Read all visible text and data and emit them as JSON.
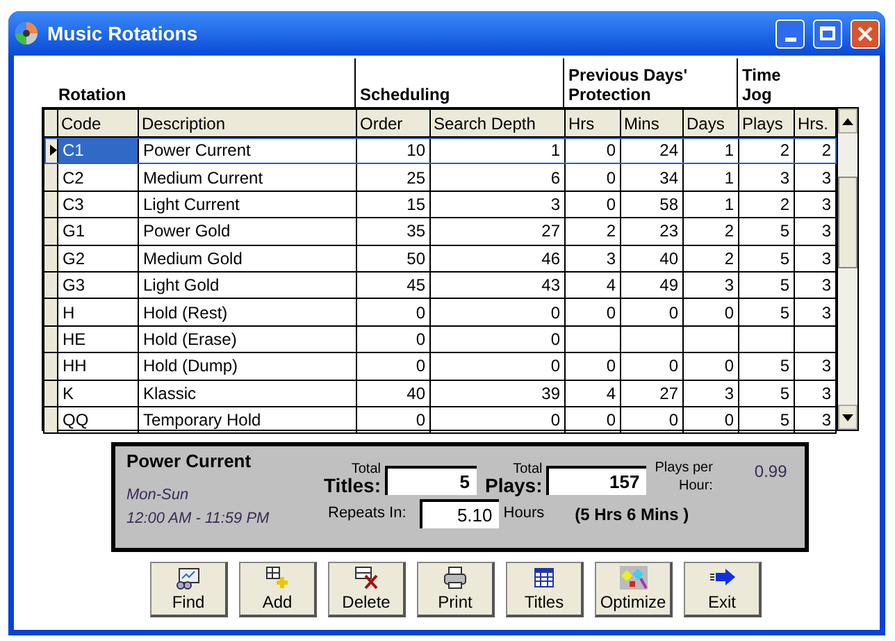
{
  "window": {
    "title": "Music Rotations"
  },
  "group_headers": [
    {
      "label": "Rotation"
    },
    {
      "label": "Scheduling"
    },
    {
      "label": "Previous Days' Protection"
    },
    {
      "label": "Time Jog"
    }
  ],
  "table": {
    "columns": [
      "Code",
      "Description",
      "Order",
      "Search Depth",
      "Hrs",
      "Mins",
      "Days",
      "Plays",
      "Hrs."
    ],
    "rows": [
      {
        "selected": true,
        "cells": [
          "C1",
          "Power Current",
          "10",
          "1",
          "0",
          "24",
          "1",
          "2",
          "2"
        ]
      },
      {
        "selected": false,
        "cells": [
          "C2",
          "Medium Current",
          "25",
          "6",
          "0",
          "34",
          "1",
          "3",
          "3"
        ]
      },
      {
        "selected": false,
        "cells": [
          "C3",
          "Light Current",
          "15",
          "3",
          "0",
          "58",
          "1",
          "2",
          "3"
        ]
      },
      {
        "selected": false,
        "cells": [
          "G1",
          "Power Gold",
          "35",
          "27",
          "2",
          "23",
          "2",
          "5",
          "3"
        ]
      },
      {
        "selected": false,
        "cells": [
          "G2",
          "Medium Gold",
          "50",
          "46",
          "3",
          "40",
          "2",
          "5",
          "3"
        ]
      },
      {
        "selected": false,
        "cells": [
          "G3",
          "Light Gold",
          "45",
          "43",
          "4",
          "49",
          "3",
          "5",
          "3"
        ]
      },
      {
        "selected": false,
        "cells": [
          "H",
          "Hold (Rest)",
          "0",
          "0",
          "0",
          "0",
          "0",
          "5",
          "3"
        ]
      },
      {
        "selected": false,
        "cells": [
          "HE",
          "Hold (Erase)",
          "0",
          "0",
          null,
          null,
          null,
          null,
          null
        ]
      },
      {
        "selected": false,
        "cells": [
          "HH",
          "Hold (Dump)",
          "0",
          "0",
          "0",
          "0",
          "0",
          "5",
          "3"
        ]
      },
      {
        "selected": false,
        "cells": [
          "K",
          "Klassic",
          "40",
          "39",
          "4",
          "27",
          "3",
          "5",
          "3"
        ]
      },
      {
        "selected": false,
        "cells": [
          "QQ",
          "Temporary Hold",
          "0",
          "0",
          "0",
          "0",
          "0",
          "5",
          "3"
        ]
      }
    ]
  },
  "summary": {
    "title": "Power Current",
    "days": "Mon-Sun",
    "hours": "12:00 AM - 11:59 PM",
    "titles_small": "Total",
    "titles_label": "Titles:",
    "titles_value": "5",
    "plays_small": "Total",
    "plays_label": "Plays:",
    "plays_value": "157",
    "per_hour_label_1": "Plays per",
    "per_hour_label_2": "Hour:",
    "per_hour_value": "0.99",
    "repeats_label": "Repeats In:",
    "repeats_value": "5.10",
    "repeats_unit": "Hours",
    "repeats_text": "(5 Hrs 6 Mins )"
  },
  "buttons": [
    {
      "label": "Find",
      "kind": "find"
    },
    {
      "label": "Add",
      "kind": "add"
    },
    {
      "label": "Delete",
      "kind": "delete"
    },
    {
      "label": "Print",
      "kind": "print"
    },
    {
      "label": "Titles",
      "kind": "titles"
    },
    {
      "label": "Optimize",
      "kind": "optimize"
    },
    {
      "label": "Exit",
      "kind": "exit"
    }
  ]
}
